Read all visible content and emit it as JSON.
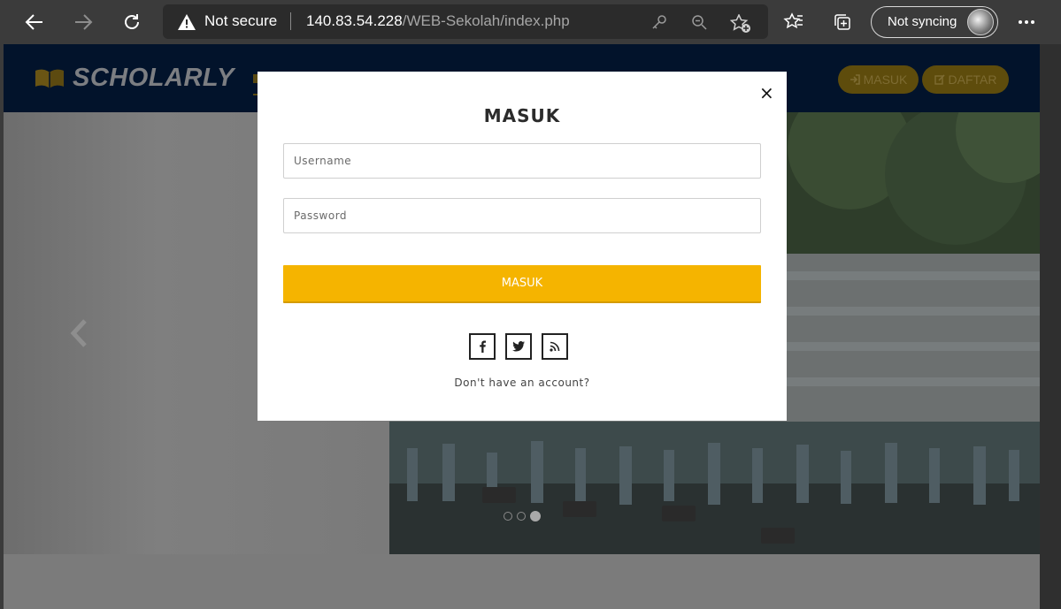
{
  "browser": {
    "security_label": "Not secure",
    "url_host": "140.83.54.228",
    "url_path": "/WEB-Sekolah/index.php",
    "sync_label": "Not syncing"
  },
  "site": {
    "logo_text": "SCHOLARLY",
    "nav_login_label": "MASUK",
    "nav_register_label": "DAFTAR"
  },
  "slider": {
    "slide_count": 3,
    "active_slide": 3
  },
  "modal": {
    "title": "MASUK",
    "close_label": "×",
    "username_placeholder": "Username",
    "password_placeholder": "Password",
    "submit_label": "MASUK",
    "social_icons": [
      "facebook-icon",
      "twitter-icon",
      "rss-icon"
    ],
    "signup_text": "Don't have an account?"
  },
  "colors": {
    "accent": "#f5b400",
    "navbar": "#02132b",
    "browser_chrome": "#3b3b3b"
  }
}
